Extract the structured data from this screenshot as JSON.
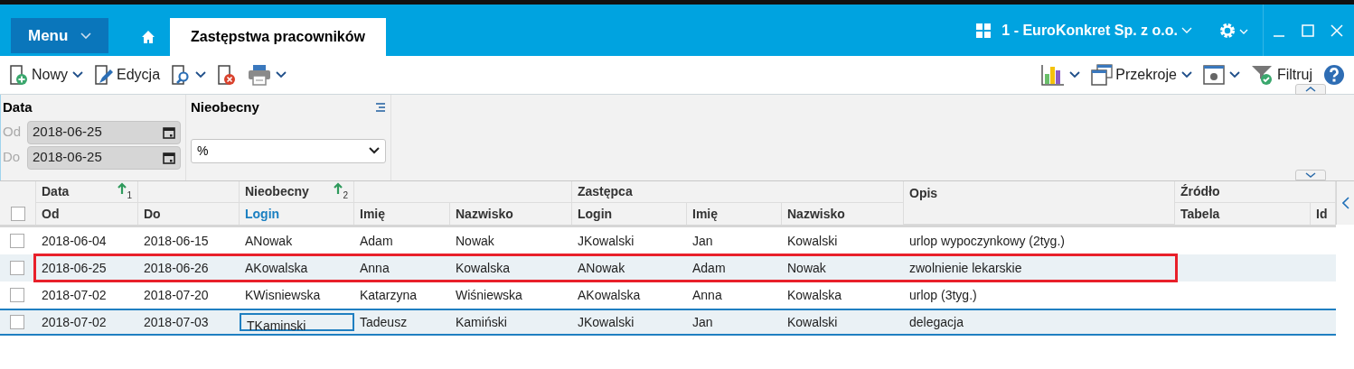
{
  "header": {
    "menu_button": "Menu",
    "home_tab": {
      "selected": false
    },
    "tab": {
      "label": "Zastępstwa pracowników",
      "selected": true
    },
    "company": "1 - EuroKonkret Sp. z o.o."
  },
  "toolbar": {
    "left": [
      {
        "kind": "new",
        "label": "Nowy",
        "dropdown": true
      },
      {
        "kind": "edit",
        "label": "Edycja",
        "dropdown": false
      },
      {
        "kind": "preview",
        "dropdown": true
      },
      {
        "kind": "delete",
        "dropdown": false
      },
      {
        "kind": "print",
        "dropdown": true
      }
    ],
    "right": [
      {
        "kind": "chart",
        "dropdown": true
      },
      {
        "kind": "views",
        "label": "Przekroje",
        "dropdown": true
      },
      {
        "kind": "settings",
        "dropdown": true
      },
      {
        "kind": "filter",
        "label": "Filtruj",
        "dropdown": false
      },
      {
        "kind": "help",
        "dropdown": false
      }
    ]
  },
  "filters": {
    "date": {
      "title": "Data",
      "from_label": "Od",
      "from": "2018-06-25",
      "to_label": "Do",
      "to": "2018-06-25"
    },
    "absent": {
      "title": "Nieobecny",
      "value": "%"
    }
  },
  "grid": {
    "all_checked": false,
    "groups": [
      {
        "label": "Data",
        "sort_index": "1",
        "columns": [
          {
            "label": "Od",
            "active": false
          }
        ]
      },
      {
        "columns": [
          {
            "label": "Do",
            "active": false
          }
        ]
      },
      {
        "label": "Nieobecny",
        "sort_index": "2",
        "columns": [
          {
            "label": "Login",
            "active": true
          }
        ]
      },
      {
        "columns": [
          {
            "label": "Imię",
            "active": false
          },
          {
            "label": "Nazwisko",
            "active": false
          }
        ]
      },
      {
        "label": "Zastępca",
        "columns": [
          {
            "label": "Login",
            "active": false
          },
          {
            "label": "Imię",
            "active": false
          },
          {
            "label": "Nazwisko",
            "active": false
          }
        ]
      },
      {
        "label": "Opis"
      },
      {
        "label": "Źródło",
        "columns": [
          {
            "label": "Tabela",
            "active": false
          },
          {
            "label": "Id",
            "active": false
          }
        ]
      }
    ],
    "rows": [
      {
        "checked": false,
        "marked": false,
        "selected": false,
        "cells": [
          {
            "text": "2018-06-04",
            "focused": false
          },
          {
            "text": "2018-06-15",
            "focused": false
          },
          {
            "text": "ANowak",
            "focused": false
          },
          {
            "text": "Adam",
            "focused": false
          },
          {
            "text": "Nowak",
            "focused": false
          },
          {
            "text": "JKowalski",
            "focused": false
          },
          {
            "text": "Jan",
            "focused": false
          },
          {
            "text": "Kowalski",
            "focused": false
          },
          {
            "text": "urlop wypoczynkowy (2tyg.)",
            "focused": false
          }
        ]
      },
      {
        "checked": false,
        "marked": true,
        "selected": false,
        "cells": [
          {
            "text": "2018-06-25",
            "focused": false
          },
          {
            "text": "2018-06-26",
            "focused": false
          },
          {
            "text": "AKowalska",
            "focused": false
          },
          {
            "text": "Anna",
            "focused": false
          },
          {
            "text": "Kowalska",
            "focused": false
          },
          {
            "text": "ANowak",
            "focused": false
          },
          {
            "text": "Adam",
            "focused": false
          },
          {
            "text": "Nowak",
            "focused": false
          },
          {
            "text": "zwolnienie lekarskie",
            "focused": false
          }
        ]
      },
      {
        "checked": false,
        "marked": false,
        "selected": false,
        "cells": [
          {
            "text": "2018-07-02",
            "focused": false
          },
          {
            "text": "2018-07-20",
            "focused": false
          },
          {
            "text": "KWisniewska",
            "focused": false
          },
          {
            "text": "Katarzyna",
            "focused": false
          },
          {
            "text": "Wiśniewska",
            "focused": false
          },
          {
            "text": "AKowalska",
            "focused": false
          },
          {
            "text": "Anna",
            "focused": false
          },
          {
            "text": "Kowalska",
            "focused": false
          },
          {
            "text": "urlop (3tyg.)",
            "focused": false
          }
        ]
      },
      {
        "checked": false,
        "marked": false,
        "selected": true,
        "cells": [
          {
            "text": "2018-07-02",
            "focused": false
          },
          {
            "text": "2018-07-03",
            "focused": false
          },
          {
            "text": "TKaminski",
            "focused": true
          },
          {
            "text": "Tadeusz",
            "focused": false
          },
          {
            "text": "Kamiński",
            "focused": false
          },
          {
            "text": "JKowalski",
            "focused": false
          },
          {
            "text": "Jan",
            "focused": false
          },
          {
            "text": "Kowalski",
            "focused": false
          },
          {
            "text": "delegacja",
            "focused": false
          }
        ]
      }
    ]
  }
}
